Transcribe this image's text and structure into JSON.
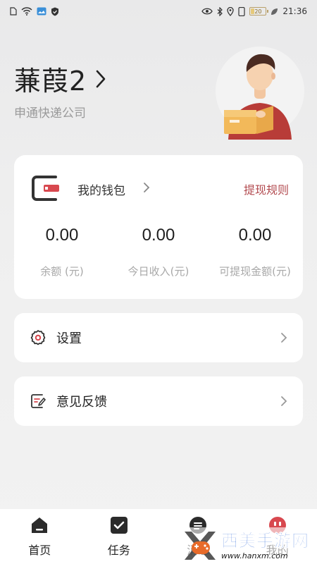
{
  "status_bar": {
    "battery_level": "20",
    "time": "21:36",
    "icons_left": [
      "sim-icon",
      "wifi-icon",
      "gallery-icon",
      "shield-icon"
    ],
    "icons_right": [
      "eye-icon",
      "bluetooth-icon",
      "location-icon",
      "battery-icon",
      "leaf-icon"
    ]
  },
  "profile": {
    "name": "蒹葭2",
    "company": "申通快递公司"
  },
  "wallet": {
    "title": "我的钱包",
    "rules_link": "提现规则",
    "stats": [
      {
        "value": "0.00",
        "label": "余额 (元)"
      },
      {
        "value": "0.00",
        "label": "今日收入(元)"
      },
      {
        "value": "0.00",
        "label": "可提现金额(元)"
      }
    ]
  },
  "menu": {
    "settings": "设置",
    "feedback": "意见反馈"
  },
  "bottom_nav": {
    "items": [
      {
        "label": "首页",
        "icon": "home-icon"
      },
      {
        "label": "任务",
        "icon": "task-icon"
      },
      {
        "label": "消息",
        "icon": "message-icon"
      },
      {
        "label": "我的",
        "icon": "profile-icon"
      }
    ]
  },
  "watermark": {
    "text": "西美手游网",
    "url": "www.hanxm.com"
  },
  "colors": {
    "accent": "#b24a4f",
    "wallet_icon_red": "#d8484f",
    "text_dark": "#222222",
    "text_muted": "#9a9a9a"
  }
}
